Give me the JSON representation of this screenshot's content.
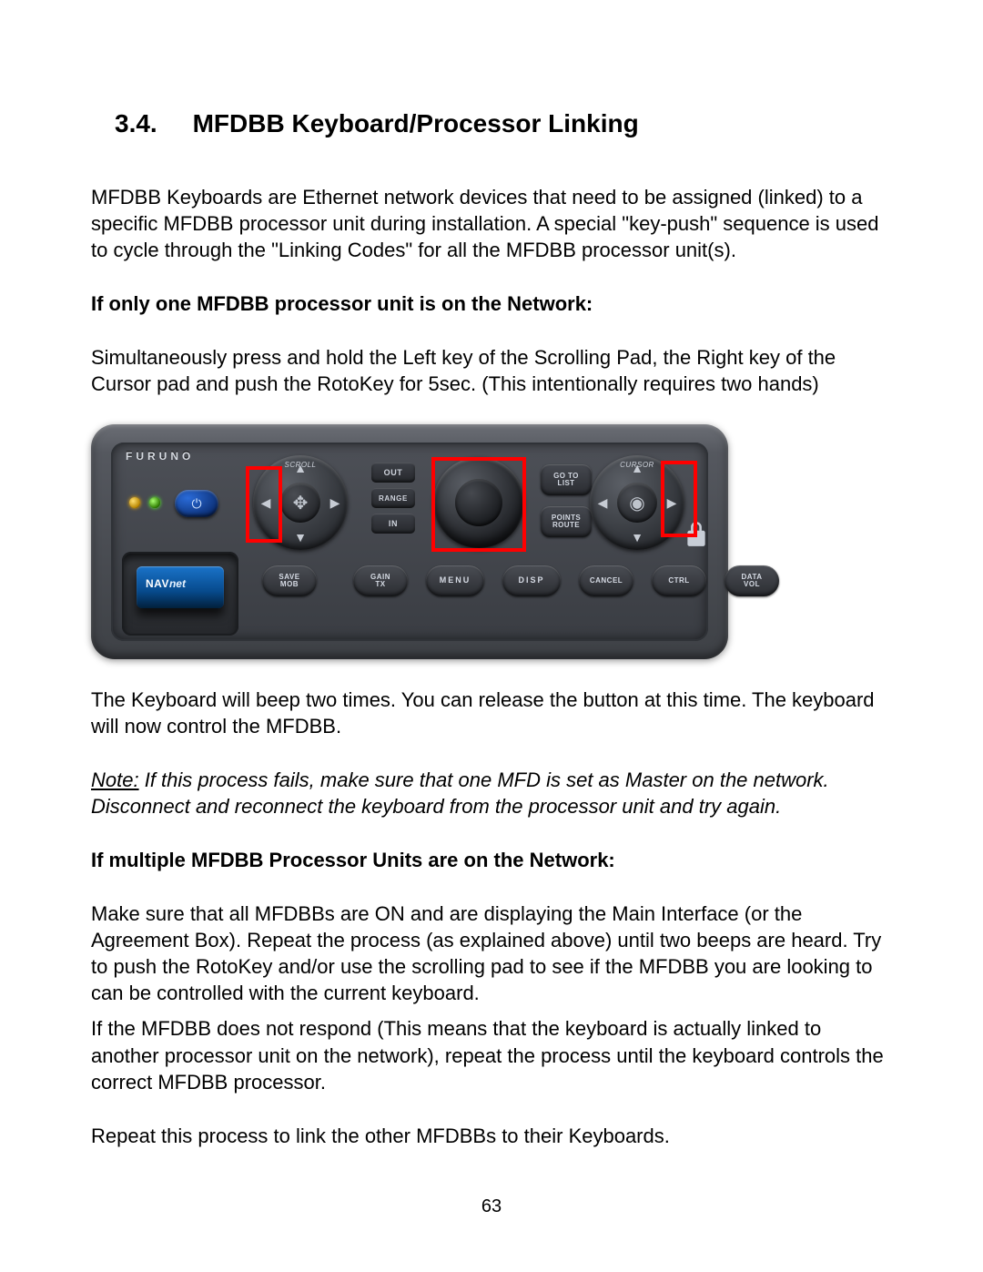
{
  "section": {
    "number": "3.4.",
    "title": "MFDBB Keyboard/Processor Linking"
  },
  "para_intro": "MFDBB Keyboards are Ethernet network devices that need to be assigned (linked) to a specific MFDBB processor unit during installation. A special \"key-push\" sequence is used to cycle through the \"Linking Codes\" for all the MFDBB processor unit(s).",
  "heading_single": "If only one MFDBB processor unit is on the Network:",
  "para_single": "Simultaneously press and hold the Left key of the Scrolling Pad, the Right key of the Cursor pad and push the RotoKey for 5sec. (This intentionally requires two hands)",
  "para_after_device": "The Keyboard will beep two times. You can release the button at this time. The keyboard will now control the MFDBB.",
  "note_prefix": "Note:",
  "note_body": " If this process fails, make sure that one MFD is set as Master on the network. Disconnect and reconnect the keyboard from the processor unit and try again.",
  "heading_multi": "If multiple MFDBB Processor Units are on the Network:",
  "para_multi_1": "Make sure that all MFDBBs are ON and are displaying the Main Interface (or the Agreement Box). Repeat the process (as explained above) until two beeps are heard. Try to push the RotoKey and/or use the scrolling pad to see if the MFDBB you are looking to can be controlled with the current keyboard.",
  "para_multi_2": "If the MFDBB does not respond (This means that the keyboard is actually linked to another processor unit on the network), repeat the process until the keyboard controls the correct MFDBB processor.",
  "para_multi_3": "Repeat this process to link the other MFDBBs to their Keyboards.",
  "page_number": "63",
  "device": {
    "brand": "FURUNO",
    "card_label_prefix": "NAV",
    "card_label_suffix": "net",
    "scrollpad_label": "SCROLL",
    "cursorpad_label": "CURSOR",
    "range": {
      "out": "OUT",
      "mid": "RANGE",
      "in": "IN"
    },
    "gotolist": {
      "l1": "GO TO",
      "l2": "LIST"
    },
    "points": {
      "l1": "POINTS",
      "l2": "ROUTE"
    },
    "ovals": {
      "save": {
        "l1": "SAVE",
        "l2": "MOB"
      },
      "gain": {
        "l1": "GAIN",
        "l2": "TX"
      },
      "menu": "MENU",
      "disp": "DISP",
      "cancel": "CANCEL",
      "ctrl": "CTRL",
      "data": {
        "l1": "DATA",
        "l2": "VOL"
      }
    }
  }
}
